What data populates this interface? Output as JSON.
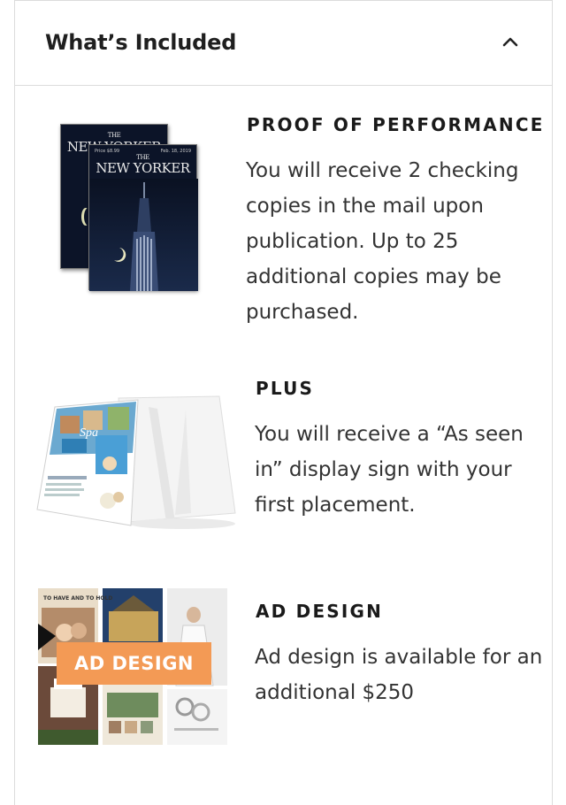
{
  "section": {
    "title": "What’s Included",
    "toggle_icon": "chevron-up-icon"
  },
  "items": [
    {
      "title": "PROOF OF PERFORMANCE",
      "lines": [
        "You will receive 2 checking",
        "copies in the mail upon",
        "publication. Up to 25",
        "additional copies may be",
        "purchased."
      ],
      "image": {
        "masthead_the": "THE",
        "masthead_name": "NEW YORKER",
        "price": "Price $8.99",
        "date": "Feb. 18, 2019"
      }
    },
    {
      "title": "PLUS",
      "lines": [
        "You will receive a “As seen",
        "in” display sign with your",
        "first placement."
      ],
      "image": {
        "sign_label": "Spa"
      }
    },
    {
      "title": "AD DESIGN",
      "lines": [
        "Ad design is available for an",
        "additional $250"
      ],
      "image": {
        "badge": "AD DESIGN",
        "tile_caption": "TO HAVE AND TO HOLD"
      }
    }
  ],
  "colors": {
    "badge": "#f39a55",
    "border": "#dcdcdc",
    "cover_bg": "#0c1428"
  }
}
